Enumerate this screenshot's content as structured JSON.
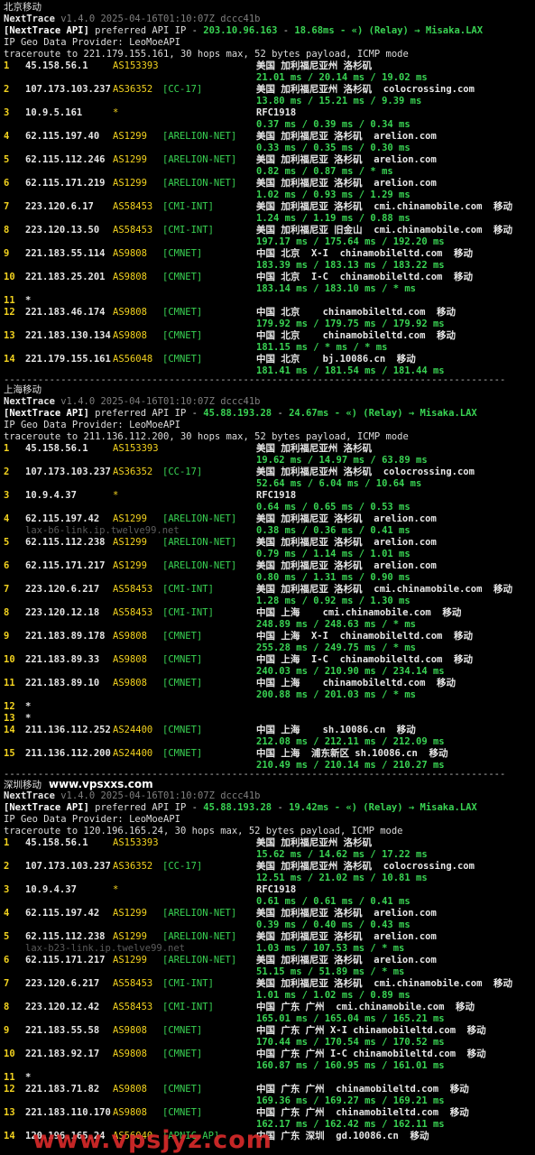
{
  "sections": [
    {
      "title": "北京移动",
      "site": "",
      "header": {
        "app": "NextTrace",
        "version": "v1.4.0 2025-04-16T01:10:07Z dccc41b",
        "api_prefix": "[NextTrace API]",
        "api_text": " preferred API IP - ",
        "api_ip": "203.10.96.163",
        "api_latency": "18.68ms",
        "relay": "- «) (Relay) → Misaka.LAX",
        "geo_line": "IP Geo Data Provider: LeoMoeAPI",
        "traceroute_line": "traceroute to 221.179.155.161, 30 hops max, 52 bytes payload, ICMP mode"
      },
      "hops": [
        {
          "n": "1",
          "ip": "45.158.56.1",
          "as": "AS153393",
          "tag": "",
          "geo": "美国 加利福尼亚州 洛杉矶",
          "rtt": "21.01 ms / 20.14 ms / 19.02 ms",
          "rdns": ""
        },
        {
          "n": "2",
          "ip": "107.173.103.237",
          "as": "AS36352",
          "tag": "[CC-17]",
          "geo": "美国 加利福尼亚州 洛杉矶  colocrossing.com",
          "rtt": "13.80 ms / 15.21 ms / 9.39 ms",
          "rdns": ""
        },
        {
          "n": "3",
          "ip": "10.9.5.161",
          "as": "*",
          "tag": "",
          "geo": "RFC1918",
          "rtt": "0.37 ms / 0.39 ms / 0.34 ms",
          "rdns": ""
        },
        {
          "n": "4",
          "ip": "62.115.197.40",
          "as": "AS1299",
          "tag": "[ARELION-NET]",
          "geo": "美国 加利福尼亚 洛杉矶  arelion.com",
          "rtt": "0.33 ms / 0.35 ms / 0.30 ms",
          "rdns": ""
        },
        {
          "n": "5",
          "ip": "62.115.112.246",
          "as": "AS1299",
          "tag": "[ARELION-NET]",
          "geo": "美国 加利福尼亚 洛杉矶  arelion.com",
          "rtt": "0.82 ms / 0.87 ms / * ms",
          "rdns": ""
        },
        {
          "n": "6",
          "ip": "62.115.171.219",
          "as": "AS1299",
          "tag": "[ARELION-NET]",
          "geo": "美国 加利福尼亚 洛杉矶  arelion.com",
          "rtt": "1.02 ms / 0.93 ms / 1.29 ms",
          "rdns": ""
        },
        {
          "n": "7",
          "ip": "223.120.6.17",
          "as": "AS58453",
          "tag": "[CMI-INT]",
          "geo": "美国 加利福尼亚 洛杉矶  cmi.chinamobile.com  移动",
          "rtt": "1.24 ms / 1.19 ms / 0.88 ms",
          "rdns": ""
        },
        {
          "n": "8",
          "ip": "223.120.13.50",
          "as": "AS58453",
          "tag": "[CMI-INT]",
          "geo": "美国 加利福尼亚 旧金山  cmi.chinamobile.com  移动",
          "rtt": "197.17 ms / 175.64 ms / 192.20 ms",
          "rdns": ""
        },
        {
          "n": "9",
          "ip": "221.183.55.114",
          "as": "AS9808",
          "tag": "[CMNET]",
          "geo": "中国 北京  X-I  chinamobileltd.com  移动",
          "rtt": "183.39 ms / 183.13 ms / 183.22 ms",
          "rdns": ""
        },
        {
          "n": "10",
          "ip": "221.183.25.201",
          "as": "AS9808",
          "tag": "[CMNET]",
          "geo": "中国 北京  I-C  chinamobileltd.com  移动",
          "rtt": "183.14 ms / 183.10 ms / * ms",
          "rdns": ""
        },
        {
          "n": "11",
          "ip": "*",
          "as": "",
          "tag": "",
          "geo": "",
          "rtt": "",
          "rdns": ""
        },
        {
          "n": "12",
          "ip": "221.183.46.174",
          "as": "AS9808",
          "tag": "[CMNET]",
          "geo": "中国 北京    chinamobileltd.com  移动",
          "rtt": "179.92 ms / 179.75 ms / 179.92 ms",
          "rdns": ""
        },
        {
          "n": "13",
          "ip": "221.183.130.134",
          "as": "AS9808",
          "tag": "[CMNET]",
          "geo": "中国 北京    chinamobileltd.com  移动",
          "rtt": "181.15 ms / * ms / * ms",
          "rdns": ""
        },
        {
          "n": "14",
          "ip": "221.179.155.161",
          "as": "AS56048",
          "tag": "[CMNET]",
          "geo": "中国 北京    bj.10086.cn  移动",
          "rtt": "181.41 ms / 181.54 ms / 181.44 ms",
          "rdns": ""
        }
      ]
    },
    {
      "title": "上海移动",
      "site": "",
      "header": {
        "app": "NextTrace",
        "version": "v1.4.0 2025-04-16T01:10:07Z dccc41b",
        "api_prefix": "[NextTrace API]",
        "api_text": " preferred API IP - ",
        "api_ip": "45.88.193.28",
        "api_latency": "24.67ms",
        "relay": "- «) (Relay) → Misaka.LAX",
        "geo_line": "IP Geo Data Provider: LeoMoeAPI",
        "traceroute_line": "traceroute to 211.136.112.200, 30 hops max, 52 bytes payload, ICMP mode"
      },
      "hops": [
        {
          "n": "1",
          "ip": "45.158.56.1",
          "as": "AS153393",
          "tag": "",
          "geo": "美国 加利福尼亚州 洛杉矶",
          "rtt": "19.62 ms / 14.97 ms / 63.89 ms",
          "rdns": ""
        },
        {
          "n": "2",
          "ip": "107.173.103.237",
          "as": "AS36352",
          "tag": "[CC-17]",
          "geo": "美国 加利福尼亚州 洛杉矶  colocrossing.com",
          "rtt": "52.64 ms / 6.04 ms / 10.64 ms",
          "rdns": ""
        },
        {
          "n": "3",
          "ip": "10.9.4.37",
          "as": "*",
          "tag": "",
          "geo": "RFC1918",
          "rtt": "0.64 ms / 0.65 ms / 0.53 ms",
          "rdns": ""
        },
        {
          "n": "4",
          "ip": "62.115.197.42",
          "as": "AS1299",
          "tag": "[ARELION-NET]",
          "geo": "美国 加利福尼亚 洛杉矶  arelion.com",
          "rtt": "0.38 ms / 0.36 ms / 0.41 ms",
          "rdns": "lax-b6-link.ip.twelve99.net"
        },
        {
          "n": "5",
          "ip": "62.115.112.238",
          "as": "AS1299",
          "tag": "[ARELION-NET]",
          "geo": "美国 加利福尼亚 洛杉矶  arelion.com",
          "rtt": "0.79 ms / 1.14 ms / 1.01 ms",
          "rdns": ""
        },
        {
          "n": "6",
          "ip": "62.115.171.217",
          "as": "AS1299",
          "tag": "[ARELION-NET]",
          "geo": "美国 加利福尼亚 洛杉矶  arelion.com",
          "rtt": "0.80 ms / 1.31 ms / 0.90 ms",
          "rdns": ""
        },
        {
          "n": "7",
          "ip": "223.120.6.217",
          "as": "AS58453",
          "tag": "[CMI-INT]",
          "geo": "美国 加利福尼亚 洛杉矶  cmi.chinamobile.com  移动",
          "rtt": "1.28 ms / 0.92 ms / 1.30 ms",
          "rdns": ""
        },
        {
          "n": "8",
          "ip": "223.120.12.18",
          "as": "AS58453",
          "tag": "[CMI-INT]",
          "geo": "中国 上海    cmi.chinamobile.com  移动",
          "rtt": "248.89 ms / 248.63 ms / * ms",
          "rdns": ""
        },
        {
          "n": "9",
          "ip": "221.183.89.178",
          "as": "AS9808",
          "tag": "[CMNET]",
          "geo": "中国 上海  X-I  chinamobileltd.com  移动",
          "rtt": "255.28 ms / 249.75 ms / * ms",
          "rdns": ""
        },
        {
          "n": "10",
          "ip": "221.183.89.33",
          "as": "AS9808",
          "tag": "[CMNET]",
          "geo": "中国 上海  I-C  chinamobileltd.com  移动",
          "rtt": "240.03 ms / 210.90 ms / 234.14 ms",
          "rdns": ""
        },
        {
          "n": "11",
          "ip": "221.183.89.10",
          "as": "AS9808",
          "tag": "[CMNET]",
          "geo": "中国 上海    chinamobileltd.com  移动",
          "rtt": "200.88 ms / 201.03 ms / * ms",
          "rdns": ""
        },
        {
          "n": "12",
          "ip": "*",
          "as": "",
          "tag": "",
          "geo": "",
          "rtt": "",
          "rdns": ""
        },
        {
          "n": "13",
          "ip": "*",
          "as": "",
          "tag": "",
          "geo": "",
          "rtt": "",
          "rdns": ""
        },
        {
          "n": "14",
          "ip": "211.136.112.252",
          "as": "AS24400",
          "tag": "[CMNET]",
          "geo": "中国 上海    sh.10086.cn  移动",
          "rtt": "212.08 ms / 212.11 ms / 212.09 ms",
          "rdns": ""
        },
        {
          "n": "15",
          "ip": "211.136.112.200",
          "as": "AS24400",
          "tag": "[CMNET]",
          "geo": "中国 上海  浦东新区 sh.10086.cn  移动",
          "rtt": "210.49 ms / 210.14 ms / 210.27 ms",
          "rdns": ""
        }
      ]
    },
    {
      "title": "深圳移动",
      "site": "www.vpsxxs.com",
      "header": {
        "app": "NextTrace",
        "version": "v1.4.0 2025-04-16T01:10:07Z dccc41b",
        "api_prefix": "[NextTrace API]",
        "api_text": " preferred API IP - ",
        "api_ip": "45.88.193.28",
        "api_latency": "19.42ms",
        "relay": "- «) (Relay) → Misaka.LAX",
        "geo_line": "IP Geo Data Provider: LeoMoeAPI",
        "traceroute_line": "traceroute to 120.196.165.24, 30 hops max, 52 bytes payload, ICMP mode"
      },
      "hops": [
        {
          "n": "1",
          "ip": "45.158.56.1",
          "as": "AS153393",
          "tag": "",
          "geo": "美国 加利福尼亚州 洛杉矶",
          "rtt": "15.62 ms / 14.62 ms / 17.22 ms",
          "rdns": ""
        },
        {
          "n": "2",
          "ip": "107.173.103.237",
          "as": "AS36352",
          "tag": "[CC-17]",
          "geo": "美国 加利福尼亚州 洛杉矶  colocrossing.com",
          "rtt": "12.51 ms / 21.02 ms / 10.81 ms",
          "rdns": ""
        },
        {
          "n": "3",
          "ip": "10.9.4.37",
          "as": "*",
          "tag": "",
          "geo": "RFC1918",
          "rtt": "0.61 ms / 0.61 ms / 0.41 ms",
          "rdns": ""
        },
        {
          "n": "4",
          "ip": "62.115.197.42",
          "as": "AS1299",
          "tag": "[ARELION-NET]",
          "geo": "美国 加利福尼亚 洛杉矶  arelion.com",
          "rtt": "0.39 ms / 0.40 ms / 0.43 ms",
          "rdns": ""
        },
        {
          "n": "5",
          "ip": "62.115.112.238",
          "as": "AS1299",
          "tag": "[ARELION-NET]",
          "geo": "美国 加利福尼亚 洛杉矶  arelion.com",
          "rtt": "1.03 ms / 107.53 ms / * ms",
          "rdns": "lax-b23-link.ip.twelve99.net"
        },
        {
          "n": "6",
          "ip": "62.115.171.217",
          "as": "AS1299",
          "tag": "[ARELION-NET]",
          "geo": "美国 加利福尼亚 洛杉矶  arelion.com",
          "rtt": "51.15 ms / 51.89 ms / * ms",
          "rdns": ""
        },
        {
          "n": "7",
          "ip": "223.120.6.217",
          "as": "AS58453",
          "tag": "[CMI-INT]",
          "geo": "美国 加利福尼亚 洛杉矶  cmi.chinamobile.com  移动",
          "rtt": "1.01 ms / 1.02 ms / 0.89 ms",
          "rdns": ""
        },
        {
          "n": "8",
          "ip": "223.120.12.42",
          "as": "AS58453",
          "tag": "[CMI-INT]",
          "geo": "中国 广东 广州  cmi.chinamobile.com  移动",
          "rtt": "165.01 ms / 165.04 ms / 165.21 ms",
          "rdns": ""
        },
        {
          "n": "9",
          "ip": "221.183.55.58",
          "as": "AS9808",
          "tag": "[CMNET]",
          "geo": "中国 广东 广州 X-I chinamobileltd.com  移动",
          "rtt": "170.44 ms / 170.54 ms / 170.52 ms",
          "rdns": ""
        },
        {
          "n": "10",
          "ip": "221.183.92.17",
          "as": "AS9808",
          "tag": "[CMNET]",
          "geo": "中国 广东 广州 I-C chinamobileltd.com  移动",
          "rtt": "160.87 ms / 160.95 ms / 161.01 ms",
          "rdns": ""
        },
        {
          "n": "11",
          "ip": "*",
          "as": "",
          "tag": "",
          "geo": "",
          "rtt": "",
          "rdns": ""
        },
        {
          "n": "12",
          "ip": "221.183.71.82",
          "as": "AS9808",
          "tag": "[CMNET]",
          "geo": "中国 广东 广州  chinamobileltd.com  移动",
          "rtt": "169.36 ms / 169.27 ms / 169.21 ms",
          "rdns": ""
        },
        {
          "n": "13",
          "ip": "221.183.110.170",
          "as": "AS9808",
          "tag": "[CMNET]",
          "geo": "中国 广东 广州  chinamobileltd.com  移动",
          "rtt": "162.17 ms / 162.42 ms / 162.11 ms",
          "rdns": ""
        },
        {
          "n": "14",
          "ip": "120.196.165.24",
          "as": "AS56040",
          "tag": "[APNIC-AP]",
          "geo": "中国 广东 深圳  gd.10086.cn  移动",
          "rtt": "",
          "rdns": ""
        }
      ]
    }
  ],
  "separator": "----------------------------------------------------------------------------------------",
  "watermark": "www.vpsjyz.com"
}
